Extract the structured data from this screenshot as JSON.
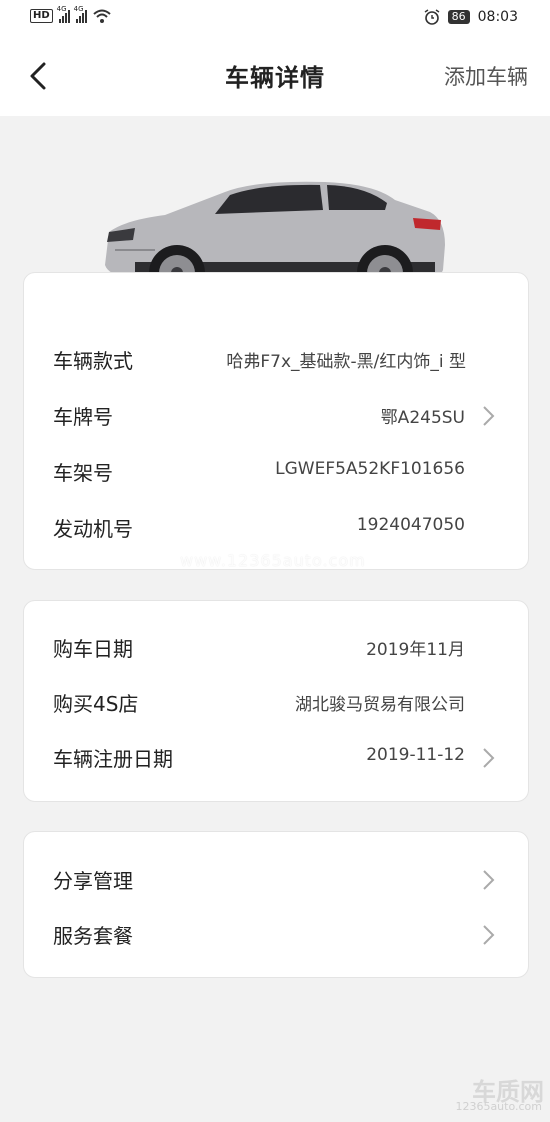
{
  "status_bar": {
    "hd": "HD",
    "net1": "4G",
    "net2": "4G",
    "battery": "86",
    "time": "08:03"
  },
  "nav": {
    "title": "车辆详情",
    "add_vehicle": "添加车辆"
  },
  "car_image": {
    "icon": "car-side-image",
    "color": "#b8b8bc"
  },
  "vehicle_info": [
    {
      "label": "车辆款式",
      "value": "哈弗F7x_基础款-黑/红内饰_i 型",
      "chevron": false
    },
    {
      "label": "车牌号",
      "value": "鄂A245SU",
      "chevron": true
    },
    {
      "label": "车架号",
      "value": "LGWEF5A52KF101656",
      "chevron": false
    },
    {
      "label": "发动机号",
      "value": "1924047050",
      "chevron": false
    }
  ],
  "purchase_info": [
    {
      "label": "购车日期",
      "value": "2019年11月",
      "chevron": false
    },
    {
      "label": "购买4S店",
      "value": "湖北骏马贸易有限公司",
      "chevron": false
    },
    {
      "label": "车辆注册日期",
      "value": "2019-11-12",
      "chevron": true
    }
  ],
  "service": [
    {
      "label": "分享管理",
      "chevron": true
    },
    {
      "label": "服务套餐",
      "chevron": true
    }
  ],
  "watermark": {
    "center": "www.12365auto.com",
    "corner_title": "车质网",
    "corner_url": "12365auto.com"
  }
}
